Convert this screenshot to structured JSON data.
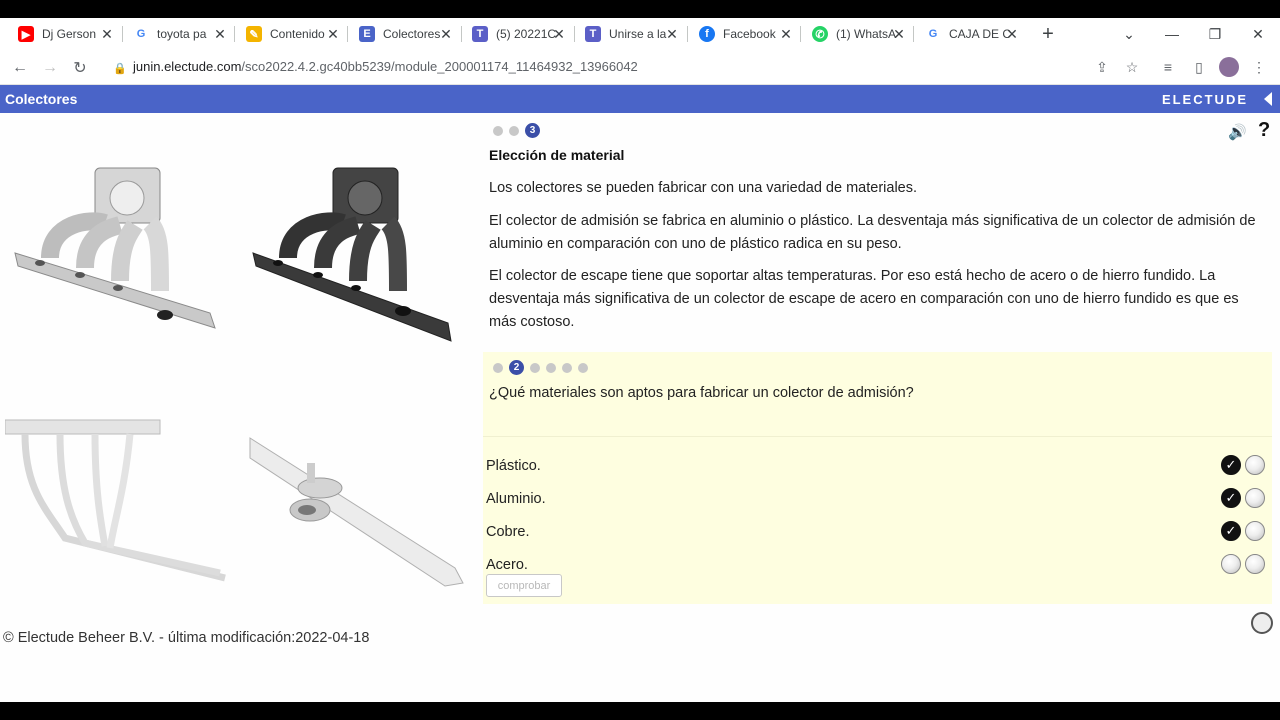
{
  "browser": {
    "tabs": [
      {
        "title": "Dj Gerson",
        "icon": "youtube-icon",
        "color": "#ff0000"
      },
      {
        "title": "toyota pa",
        "icon": "google-icon",
        "color": "#4285f4"
      },
      {
        "title": "Contenido",
        "icon": "notes-icon",
        "color": "#f4b400"
      },
      {
        "title": "Colectores",
        "icon": "electude-icon",
        "color": "#4a64c8"
      },
      {
        "title": "(5) 20221C",
        "icon": "teams-icon",
        "color": "#5b5fc7"
      },
      {
        "title": "Unirse a la",
        "icon": "teams-icon",
        "color": "#5b5fc7"
      },
      {
        "title": "Facebook",
        "icon": "facebook-icon",
        "color": "#1877f2"
      },
      {
        "title": "(1) WhatsA",
        "icon": "whatsapp-icon",
        "color": "#25d366"
      },
      {
        "title": "CAJA DE C",
        "icon": "google-icon",
        "color": "#4285f4"
      }
    ],
    "url_host": "junin.electude.com",
    "url_path": "/sco2022.4.2.gc40bb5239/module_200001174_11464932_13966042"
  },
  "app": {
    "title": "Colectores",
    "brand": "ELECTUDE"
  },
  "lesson": {
    "step": "3",
    "heading": "Elección de material",
    "paragraphs": [
      "Los colectores se pueden fabricar con una variedad de materiales.",
      "El colector de admisión se fabrica en aluminio o plástico. La desventaja más significativa de un colector de admisión de aluminio en comparación con uno de plástico radica en su peso.",
      "El colector de escape tiene que soportar altas temperaturas. Por eso está hecho de acero o de hierro fundido. La desventaja más significativa de un colector de escape de acero en comparación con uno de hierro fundido es que es más costoso."
    ]
  },
  "quiz": {
    "step": "2",
    "question": "¿Qué materiales son aptos para fabricar un colector de admisión?",
    "options": [
      {
        "label": "Plástico.",
        "selected": true
      },
      {
        "label": "Aluminio.",
        "selected": true
      },
      {
        "label": "Cobre.",
        "selected": true
      },
      {
        "label": "Acero.",
        "selected": false
      }
    ],
    "check_label": "comprobar"
  },
  "footer": {
    "text": "© Electude Beheer B.V. - última modificación:2022-04-18"
  }
}
